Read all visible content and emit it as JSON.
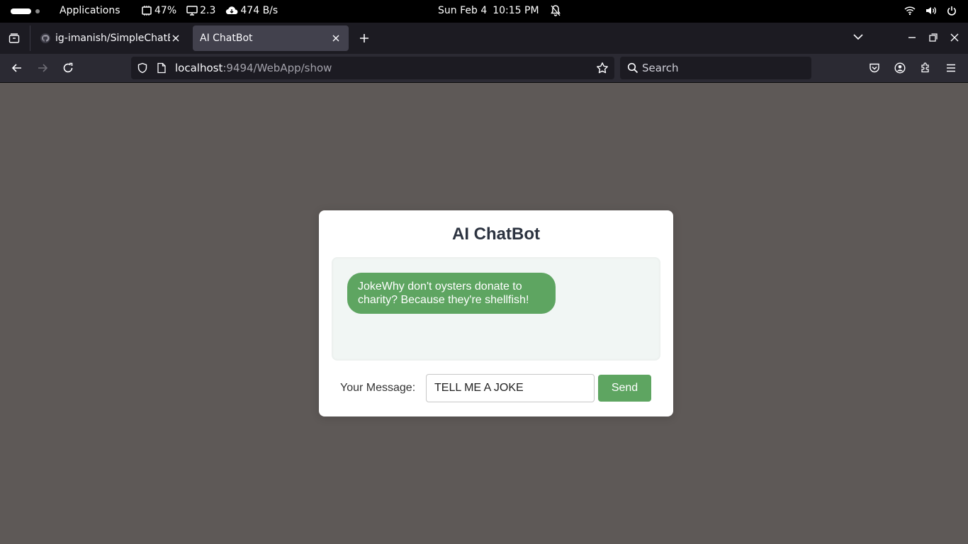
{
  "topbar": {
    "apps_label": "Applications",
    "cpu": "47%",
    "load": "2.3",
    "net": "474 B/s",
    "date": "Sun Feb 4",
    "time": "10:15 PM"
  },
  "browser": {
    "tabs": [
      {
        "title": "ig-imanish/SimpleChatBot"
      },
      {
        "title": "AI ChatBot"
      }
    ],
    "url": {
      "host": "localhost",
      "path": ":9494/WebApp/show"
    },
    "search_placeholder": "Search"
  },
  "page": {
    "title": "AI ChatBot",
    "messages": [
      {
        "text": "JokeWhy don't oysters donate to charity? Because they're shellfish!"
      }
    ],
    "input_label": "Your Message:",
    "input_value": "TELL ME A JOKE",
    "send_label": "Send"
  },
  "colors": {
    "accent": "#5ea561",
    "page_bg": "#5e5957",
    "chat_bg": "#f1f6f4",
    "title": "#2c3340"
  }
}
